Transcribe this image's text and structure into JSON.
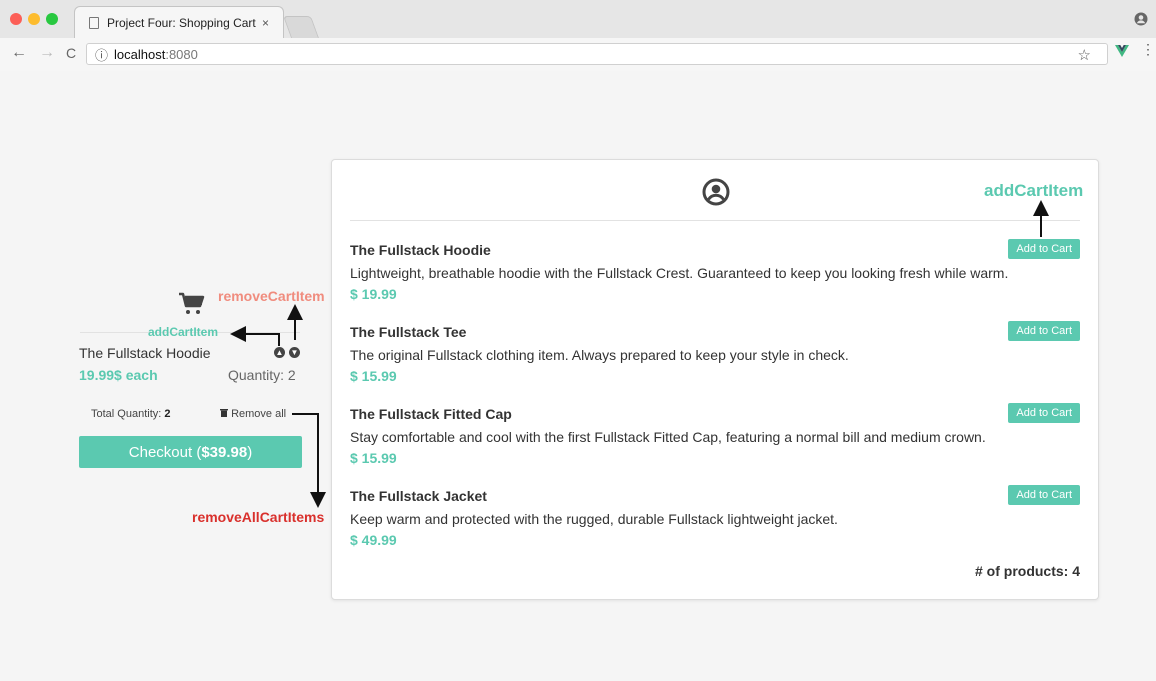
{
  "browser": {
    "tab_title": "Project Four: Shopping Cart",
    "tab_close": "×",
    "url_host": "localhost",
    "url_port": ":8080",
    "back": "←",
    "forward": "→",
    "reload": "C",
    "info": "ⓘ",
    "star": "☆",
    "menu": "⋮"
  },
  "products": [
    {
      "name": "The Fullstack Hoodie",
      "description": "Lightweight, breathable hoodie with the Fullstack Crest. Guaranteed to keep you looking fresh while warm.",
      "price": "$ 19.99",
      "button": "Add to Cart"
    },
    {
      "name": "The Fullstack Tee",
      "description": "The original Fullstack clothing item. Always prepared to keep your style in check.",
      "price": "$ 15.99",
      "button": "Add to Cart"
    },
    {
      "name": "The Fullstack Fitted Cap",
      "description": "Stay comfortable and cool with the first Fullstack Fitted Cap, featuring a normal bill and medium crown.",
      "price": "$ 15.99",
      "button": "Add to Cart"
    },
    {
      "name": "The Fullstack Jacket",
      "description": "Keep warm and protected with the rugged, durable Fullstack lightweight jacket.",
      "price": "$ 49.99",
      "button": "Add to Cart"
    }
  ],
  "product_count": "# of products: 4",
  "cart": {
    "item_name": "The Fullstack Hoodie",
    "item_price": "19.99$ each",
    "item_quantity": "Quantity: 2",
    "total_label": "Total Quantity: ",
    "total_value": "2",
    "remove_all": "Remove all",
    "checkout_prefix": "Checkout (",
    "checkout_total": "$39.98",
    "checkout_suffix": ")"
  },
  "annotations": {
    "add_cart_item_panel": "addCartItem",
    "remove_cart_item": "removeCartItem",
    "add_cart_item_cart": "addCartItem",
    "remove_all_cart_items": "removeAllCartItems"
  },
  "colors": {
    "accent": "#5bc9b0",
    "remove_annotation": "#f08c7e",
    "remove_all_annotation": "#d9302c"
  }
}
